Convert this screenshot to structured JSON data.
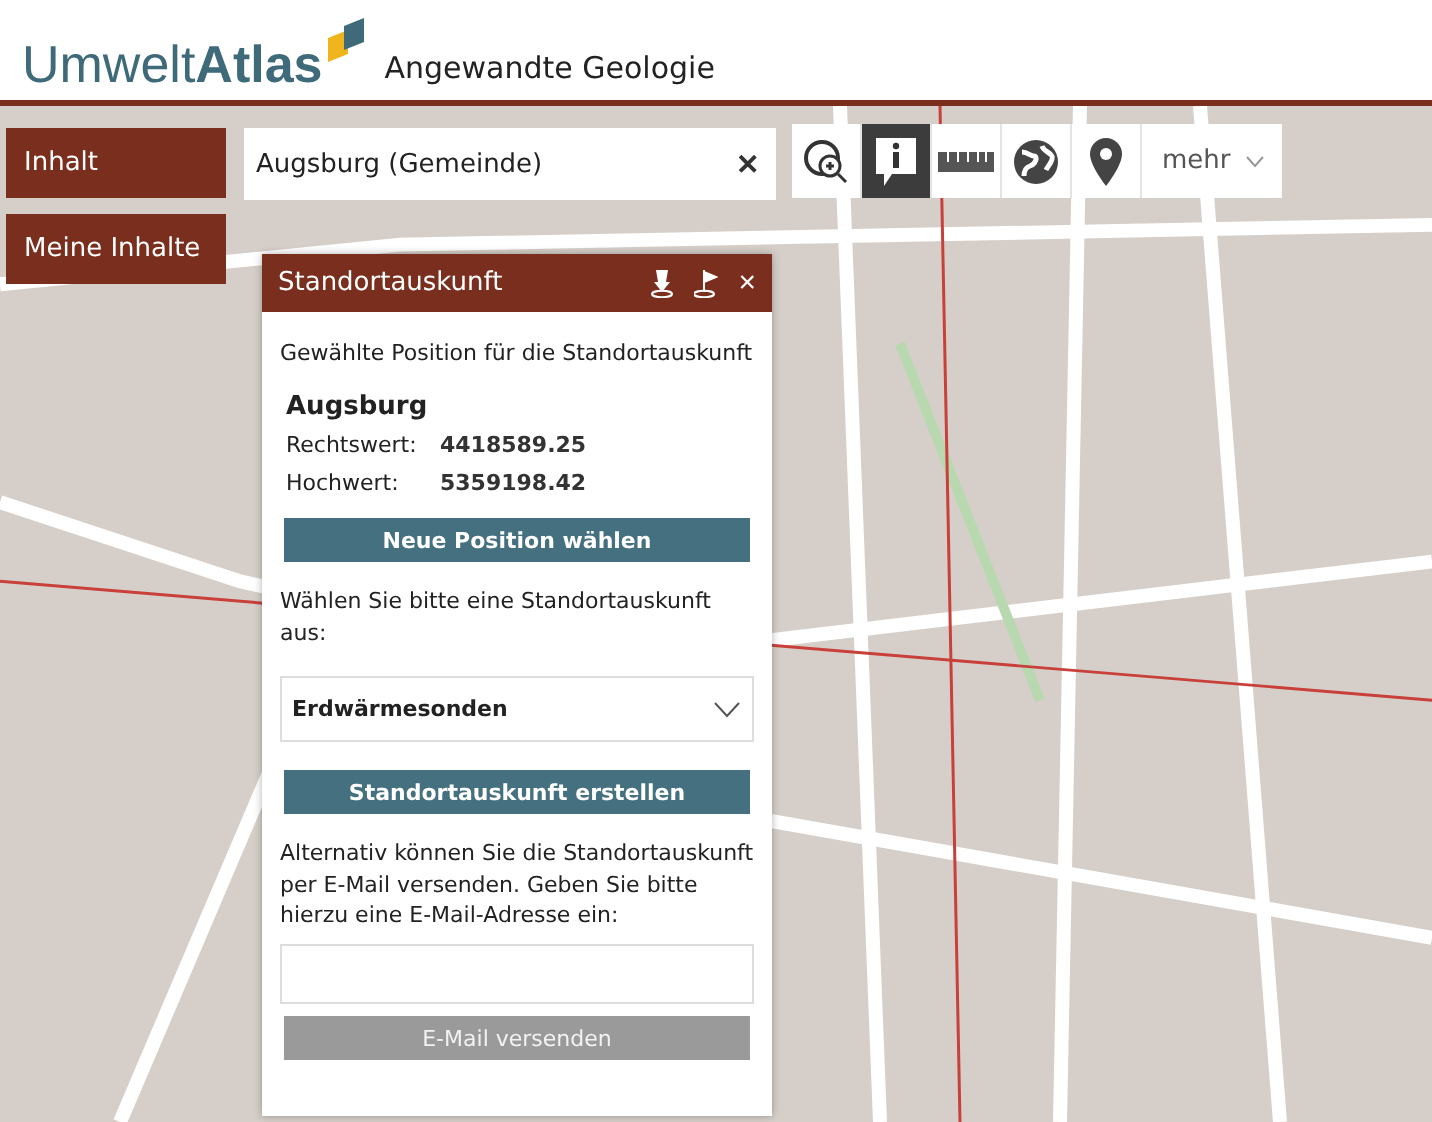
{
  "header": {
    "logo": "Umwelt**Atlas**",
    "subtitle": "Angewandte Geologie"
  },
  "nav_buttons": [
    "Inhalt",
    "Meine Inhalte"
  ],
  "search": {
    "value": "Augsburg (Gemeinde)",
    "clear": "✕"
  },
  "tools": [
    {
      "selected": false
    },
    {
      "selected": true
    },
    {
      "selected": false
    },
    {
      "selected": false
    },
    {
      "selected": false
    }
  ],
  "more_menu": {
    "label": "mehr"
  },
  "panel": {
    "title": "Standortauskunft",
    "close": "×",
    "intro": "Gewählte Position für die Standortauskunft",
    "place": "Augsburg",
    "coords": [
      {
        "label": "Rechtswert:",
        "value": "4418589.25"
      },
      {
        "label": "Hochwert:",
        "value": "5359198.42"
      }
    ],
    "new_position_button": "Neue Position wählen",
    "choose_text": "Wählen Sie bitte eine Standortauskunft aus:",
    "dropdown": {
      "value": "Erdwärmesonden"
    },
    "create_button": "Standortauskunft erstellen",
    "email_text": "Alternativ können Sie die Standortauskunft per E-Mail versenden. Geben Sie bitte hierzu eine E-Mail-Adresse ein:",
    "send_button": {
      "label": "E-Mail versenden",
      "disabled": true
    }
  }
}
